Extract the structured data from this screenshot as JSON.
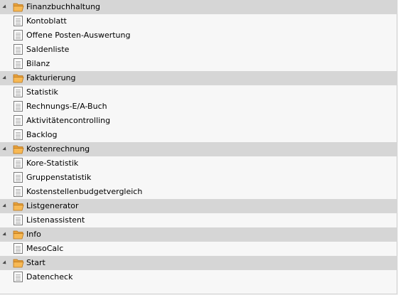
{
  "tree": {
    "groups": [
      {
        "label": "Finanzbuchhaltung",
        "icon": "open-folder-icon",
        "items": [
          "Kontoblatt",
          "Offene Posten-Auswertung",
          "Saldenliste",
          "Bilanz"
        ]
      },
      {
        "label": "Fakturierung",
        "icon": "open-folder-icon",
        "items": [
          "Statistik",
          "Rechnungs-E/A-Buch",
          "Aktivitätencontrolling",
          "Backlog"
        ]
      },
      {
        "label": "Kostenrechnung",
        "icon": "open-folder-icon",
        "items": [
          "Kore-Statistik",
          "Gruppenstatistik",
          "Kostenstellenbudgetvergleich"
        ]
      },
      {
        "label": "Listgenerator",
        "icon": "open-folder-icon",
        "items": [
          "Listenassistent"
        ]
      },
      {
        "label": "Info",
        "icon": "open-folder-icon",
        "items": [
          "MesoCalc"
        ]
      },
      {
        "label": "Start",
        "icon": "open-folder-icon",
        "items": [
          "Datencheck"
        ]
      }
    ],
    "colors": {
      "header_bg": "#d6d6d6",
      "item_bg": "#f7f7f7",
      "folder": "#f0a030"
    }
  }
}
